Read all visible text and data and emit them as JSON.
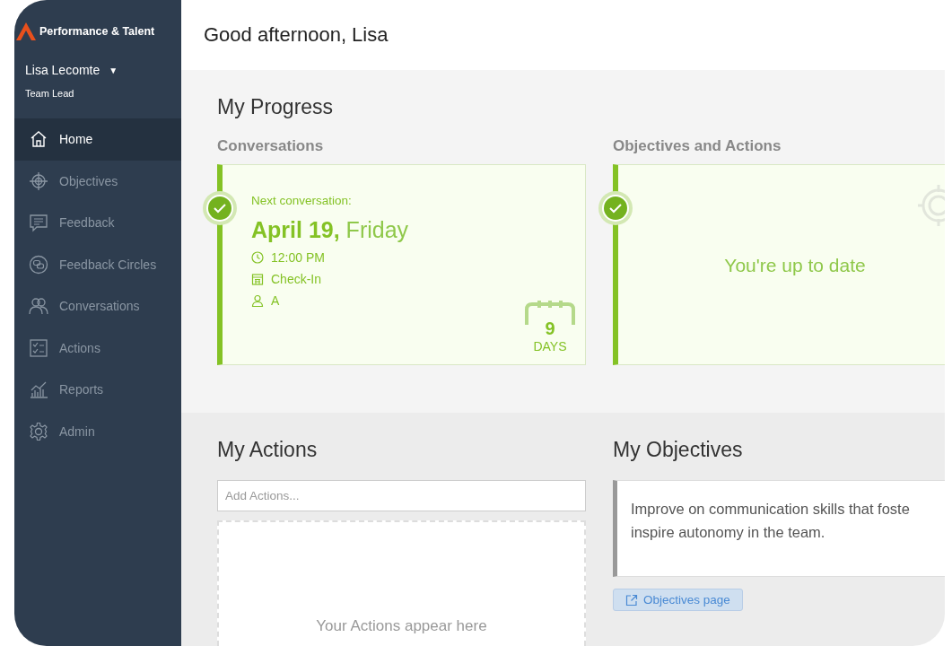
{
  "brand": {
    "name": "Performance & Talent"
  },
  "user": {
    "name": "Lisa Lecomte",
    "caret": "▼",
    "role": "Team Lead"
  },
  "sidebar": {
    "items": [
      {
        "label": "Home",
        "selected": true
      },
      {
        "label": "Objectives",
        "selected": false
      },
      {
        "label": "Feedback",
        "selected": false
      },
      {
        "label": "Feedback Circles",
        "selected": false
      },
      {
        "label": "Conversations",
        "selected": false
      },
      {
        "label": "Actions",
        "selected": false
      },
      {
        "label": "Reports",
        "selected": false
      },
      {
        "label": "Admin",
        "selected": false
      }
    ]
  },
  "header": {
    "greeting": "Good afternoon, Lisa"
  },
  "progress": {
    "title": "My Progress",
    "conversations": {
      "title": "Conversations",
      "done": true,
      "label": "Next conversation:",
      "date": "April 19,",
      "weekday": "Friday",
      "time": "12:00 PM",
      "type": "Check-In",
      "attendee": "A",
      "days": "9",
      "days_label": "DAYS"
    },
    "objectives": {
      "title": "Objectives and Actions",
      "done": true,
      "message": "You're up to date"
    }
  },
  "actions": {
    "title": "My Actions",
    "placeholder": "Add Actions...",
    "empty": "Your Actions appear here"
  },
  "objectives": {
    "title": "My Objectives",
    "lines": [
      "Improve on communication skills that foste",
      "inspire autonomy in the team."
    ],
    "link": "Objectives page"
  }
}
